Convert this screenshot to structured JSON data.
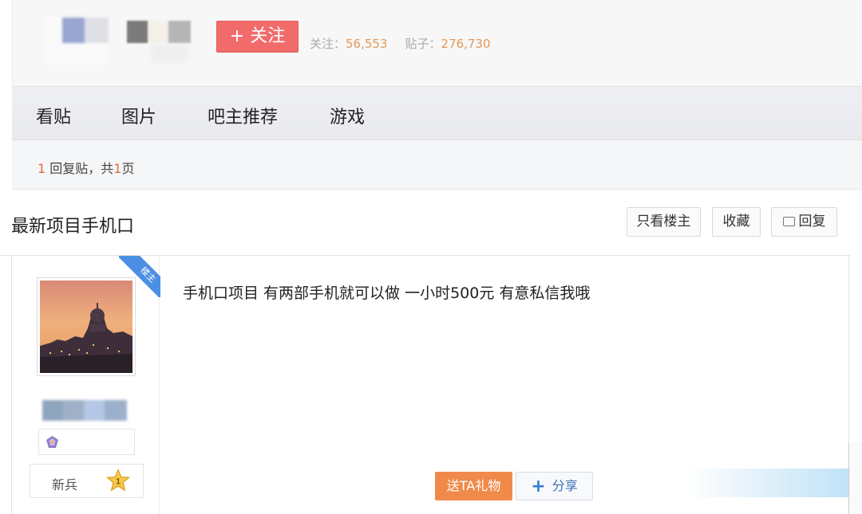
{
  "header": {
    "follow_label": "+ 关注",
    "followers_label": "关注：",
    "followers_count": "56,553",
    "posts_label": "贴子：",
    "posts_count": "276,730"
  },
  "tabs": [
    "看贴",
    "图片",
    "吧主推荐",
    "游戏"
  ],
  "pager": {
    "reply_count": "1",
    "reply_text": " 回复贴，共",
    "page_count": "1",
    "page_suffix": "页"
  },
  "thread": {
    "title": "最新项目手机口",
    "only_author_label": "只看楼主",
    "favorite_label": "收藏",
    "reply_label": "回复"
  },
  "post": {
    "author_ribbon": "楼主",
    "rank_title": "新兵",
    "rank_level": "1",
    "content": "手机口项目 有两部手机就可以做 一小时500元 有意私信我哦",
    "gift_label": "送TA礼物",
    "share_label": "分享"
  },
  "colors": {
    "follow_button": "#f26b6b",
    "stat_numbers": "#e29a58",
    "gift_button": "#f08a4b",
    "ribbon": "#4b8fe4"
  }
}
